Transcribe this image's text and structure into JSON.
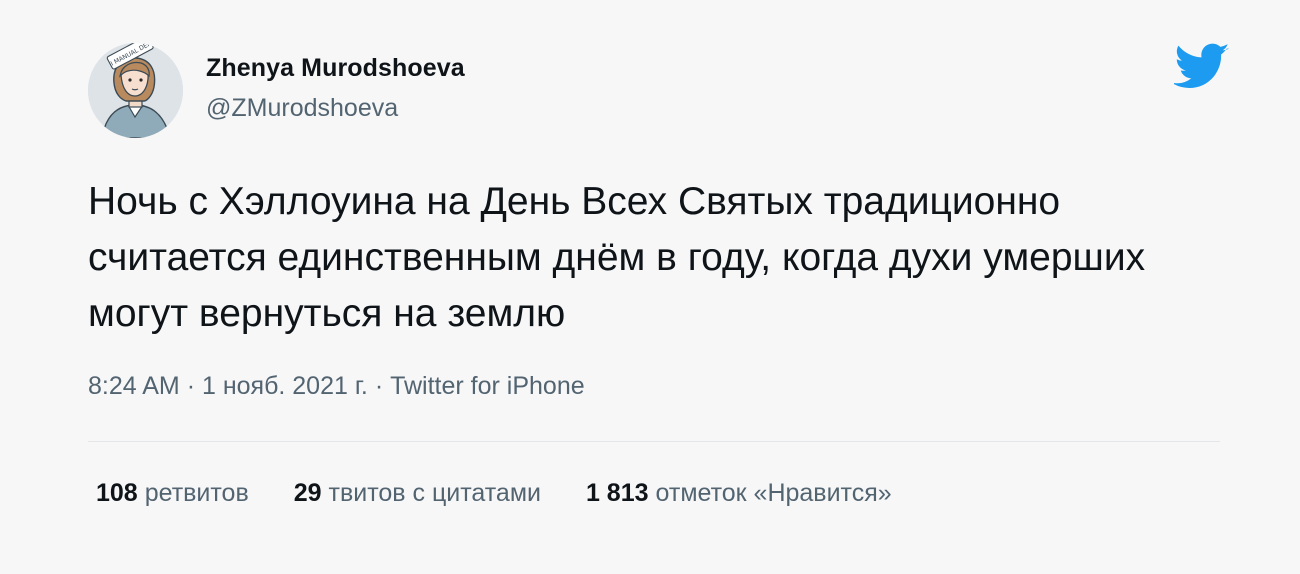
{
  "author": {
    "name": "Zhenya Murodshoeva",
    "handle": "@ZMurodshoeva",
    "avatar_icon": "user-avatar-illustration",
    "avatar_sign_text": "I MANUAL DEF"
  },
  "brand": {
    "icon": "twitter-bird-icon",
    "color": "#1d9bf0"
  },
  "tweet": {
    "text": "Ночь с Хэллоуина на День Всех Святых традиционно считается единственным днём в году, когда духи умерших могут вернуться на землю",
    "time": "8:24 AM",
    "date": "1 нояб. 2021 г.",
    "source": "Twitter for iPhone",
    "separator": "·"
  },
  "stats": {
    "retweets_count": "108",
    "retweets_label": "ретвитов",
    "quotes_count": "29",
    "quotes_label": "твитов с цитатами",
    "likes_count": "1 813",
    "likes_label": "отметок «Нравится»"
  },
  "colors": {
    "background": "#f7f7f8",
    "text_primary": "#0f1419",
    "text_secondary": "#536471"
  }
}
